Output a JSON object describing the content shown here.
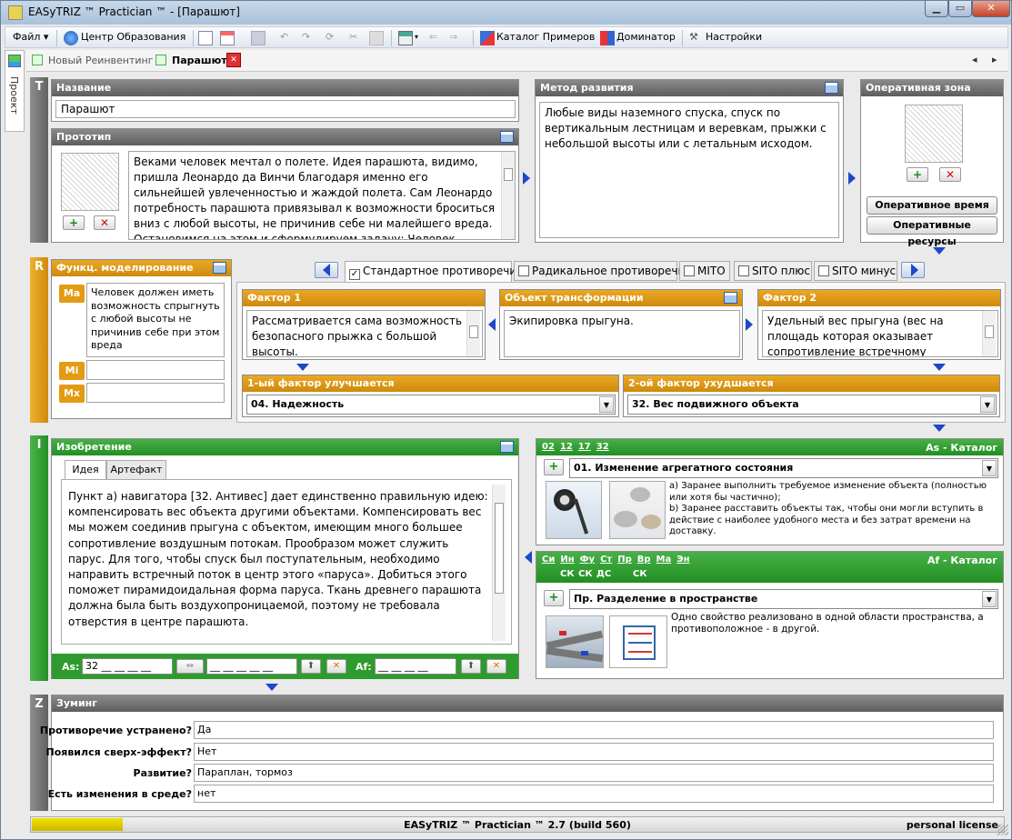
{
  "window": {
    "title": "EASyTRIZ ™ Practician ™ - [Парашют]"
  },
  "menu": {
    "file": "Файл",
    "education": "Центр Образования",
    "catalog_examples": "Каталог Примеров",
    "dominator": "Доминатор",
    "settings": "Настройки"
  },
  "tabs": {
    "new_reinvent": "Новый Реинвентинг",
    "parachute": "Парашют"
  },
  "side": {
    "project": "Проект"
  },
  "sections": {
    "T": "T",
    "R": "R",
    "I": "I",
    "Z": "Z"
  },
  "t_section": {
    "name_title": "Название",
    "name_value": "Парашют",
    "prototype_title": "Прототип",
    "prototype_text": "Веками человек мечтал о полете. Идея парашюта, видимо, пришла Леонардо да Винчи благодаря именно его сильнейшей увлеченностью и жаждой полета. Сам Леонардо потребность парашюта привязывал к возможности броситься вниз с любой высоты, не причинив себе ни малейшего вреда. Остановимся на этом и сформулируем задачу: Человек должен иметь",
    "method_title": "Метод развития",
    "method_text": "Любые виды наземного спуска, спуск по вертикальным лестницам и веревкам, прыжки с небольшой высоты или с летальным исходом.",
    "opzone_title": "Оперативная зона",
    "optime_btn": "Оперативное время",
    "opres_btn": "Оперативные ресурсы"
  },
  "r_section": {
    "func_title": "Функц. моделирование",
    "ma_label": "Ма",
    "ma_text": "Человек должен иметь возможность спрыгнуть с любой высоты не причинив себе при этом вреда",
    "mi_label": "Mi",
    "mx_label": "Mx",
    "tabs": [
      "Стандартное противоречие",
      "Радикальное противоречие",
      "MITO",
      "SITO плюс",
      "SITO минус"
    ],
    "factor1_title": "Фактор 1",
    "factor1_text": "Рассматривается сама возможность безопасного прыжка с большой высоты.",
    "object_title": "Объект трансформации",
    "object_text": "Экипировка прыгуна.",
    "factor2_title": "Фактор 2",
    "factor2_text": "Удельный вес прыгуна (вес на площадь которая оказывает сопротивление встречному воздуху).",
    "improves_title": "1-ый фактор улучшается",
    "improves_value": "04. Надежность",
    "worsens_title": "2-ой фактор ухудшается",
    "worsens_value": "32. Вес подвижного объекта"
  },
  "i_section": {
    "invention_title": "Изобретение",
    "tab_idea": "Идея",
    "tab_artifact": "Артефакт",
    "idea_text": "Пункт а) навигатора  [32. Антивес]  дает единственно правильную идею: компенсировать вес объекта другими объектами. Компенсировать вес мы можем соединив прыгуна с объектом, имеющим много большее сопротивление воздушным потокам. Прообразом может служить парус. Для того, чтобы спуск был поступательным, необходимо направить встречный поток в центр этого «паруса». Добиться этого поможет пирамидоидальная форма паруса. Ткань древнего парашюта должна была быть воздухопроницаемой, поэтому не требовала отверстия в центре парашюта.",
    "as_label": "As:",
    "as_value": "32 __ __ __ __",
    "as_value2": "__ __ __ __ __",
    "af_label": "Af:",
    "af_value": "__ __ __ __"
  },
  "as_catalog": {
    "links": [
      "02",
      "12",
      "17",
      "32"
    ],
    "title": "As - Каталог",
    "selected": "01. Изменение агрегатного состояния",
    "text": "а) Заранее выполнить требуемое изменение объекта (полностью или хотя бы частично);\nb) Заранее расставить объекты так, чтобы они могли вступить в действие с наиболее удобного места и без затрат времени на доставку."
  },
  "af_catalog": {
    "links_top": [
      "Си",
      "Ин",
      "Фу",
      "Ст",
      "Пр",
      "Вр",
      "Ма",
      "Эн"
    ],
    "links_bottom": [
      "СК",
      "СК",
      "ДС",
      "СК"
    ],
    "title": "Af - Каталог",
    "selected": "Пр. Разделение в пространстве",
    "text": "Одно свойство реализовано в одной области пространства, а противоположное - в другой."
  },
  "z_section": {
    "title": "Зуминг",
    "rows": [
      {
        "label": "Противоречие устранено?",
        "value": "Да"
      },
      {
        "label": "Появился сверх-эффект?",
        "value": "Нет"
      },
      {
        "label": "Развитие?",
        "value": "Параплан, тормоз"
      },
      {
        "label": "Есть изменения в среде?",
        "value": "нет"
      }
    ]
  },
  "status": {
    "center": "EASyTRIZ ™ Practician ™ 2.7 (build 560)",
    "right": "personal license"
  },
  "colors": {
    "orange": "#e39b13",
    "green": "#2e9b2e",
    "gray": "#6e6e6e",
    "accent": "#1f47c8"
  }
}
